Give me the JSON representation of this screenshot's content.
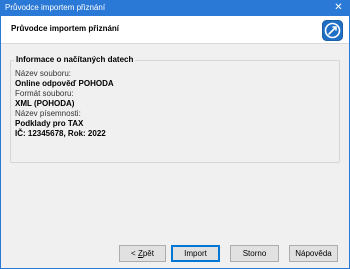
{
  "window": {
    "title": "Průvodce importem přiznání",
    "close_glyph": "✕"
  },
  "header": {
    "title": "Průvodce importem přiznání",
    "logo_icon": "pohoda-logo-icon",
    "accent": "#2b79d6"
  },
  "info": {
    "legend": "Informace o načítaných datech",
    "file_name_label": "Název souboru:",
    "file_name_value": "Online odpověď POHODA",
    "file_format_label": "Formát souboru:",
    "file_format_value": "XML (POHODA)",
    "document_name_label": "Název písemnosti:",
    "document_name_value": "Podklady pro TAX",
    "id_line": "IČ: 12345678, Rok: 2022"
  },
  "buttons": {
    "back_prefix": "< ",
    "back_mnemonic": "Z",
    "back_rest": "pět",
    "import": "Import",
    "cancel": "Storno",
    "help": "Nápověda"
  }
}
